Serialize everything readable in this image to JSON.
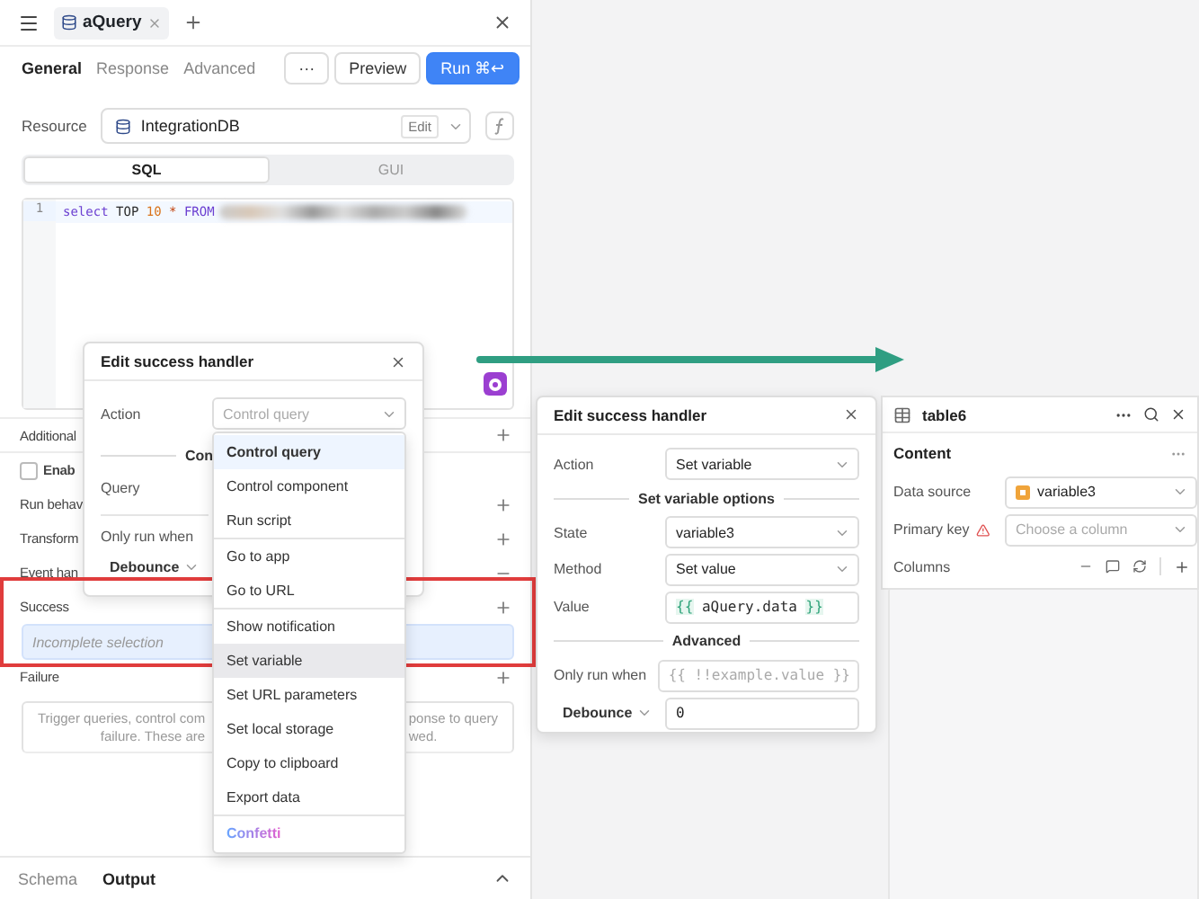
{
  "query_panel": {
    "file_tabs": [
      {
        "label": "aQuery",
        "selected": true
      }
    ],
    "tabs": [
      {
        "label": "General",
        "selected": true
      },
      {
        "label": "Response",
        "selected": false
      },
      {
        "label": "Advanced",
        "selected": false
      }
    ],
    "buttons": [
      {
        "kind": "more",
        "label": "···"
      },
      {
        "kind": "secondary",
        "label": "Preview"
      },
      {
        "kind": "primary",
        "label": "Run",
        "shortcut": "⌘↩"
      }
    ],
    "resource": {
      "label": "Resource",
      "value": "IntegrationDB",
      "edit": "Edit"
    },
    "modes": [
      {
        "label": "SQL",
        "selected": true
      },
      {
        "label": "GUI",
        "selected": false
      }
    ],
    "code": {
      "line_number": "1",
      "tokens": [
        {
          "kind": "keyword",
          "text": "select"
        },
        {
          "kind": "plain",
          "text": "TOP"
        },
        {
          "kind": "number",
          "text": "10"
        },
        {
          "kind": "operator",
          "text": "*"
        },
        {
          "kind": "keyword",
          "text": "FROM"
        }
      ]
    },
    "sections": [
      {
        "kind": "row",
        "label": "Additional",
        "expanded": false
      },
      {
        "kind": "checkbox",
        "label": "Enab",
        "checked": false
      },
      {
        "kind": "row",
        "label": "Run behav",
        "expanded": false
      },
      {
        "kind": "row",
        "label": "Transform",
        "expanded": false
      },
      {
        "kind": "row",
        "label": "Event han",
        "expanded": true
      },
      {
        "kind": "row",
        "label": "Success",
        "expanded": false
      },
      {
        "kind": "handler",
        "label": "Incomplete selection"
      },
      {
        "kind": "row",
        "label": "Failure",
        "expanded": false
      },
      {
        "kind": "help",
        "left": [
          "Trigger queries, control com",
          "failure. These are"
        ],
        "right": [
          "ponse to query",
          "wed."
        ]
      }
    ],
    "bottom_tabs": [
      {
        "label": "Schema",
        "selected": false
      },
      {
        "label": "Output",
        "selected": true
      }
    ]
  },
  "left_handler": {
    "title": "Edit success handler",
    "action_label": "Action",
    "action_placeholder": "Control query",
    "section": "Con",
    "query_label": "Query",
    "only_run_when": "Only run when",
    "debounce": "Debounce"
  },
  "action_menu": {
    "groups": [
      [
        {
          "label": "Control query",
          "selected": true,
          "hovered": false
        },
        {
          "label": "Control component",
          "selected": false,
          "hovered": false
        },
        {
          "label": "Run script",
          "selected": false,
          "hovered": false
        }
      ],
      [
        {
          "label": "Go to app",
          "selected": false,
          "hovered": false
        },
        {
          "label": "Go to URL",
          "selected": false,
          "hovered": false
        }
      ],
      [
        {
          "label": "Show notification",
          "selected": false,
          "hovered": false
        },
        {
          "label": "Set variable",
          "selected": false,
          "hovered": true
        },
        {
          "label": "Set URL parameters",
          "selected": false,
          "hovered": false
        },
        {
          "label": "Set local storage",
          "selected": false,
          "hovered": false
        },
        {
          "label": "Copy to clipboard",
          "selected": false,
          "hovered": false
        },
        {
          "label": "Export data",
          "selected": false,
          "hovered": false
        }
      ],
      [
        {
          "label": "Confetti",
          "selected": false,
          "hovered": false,
          "kind": "special"
        }
      ]
    ]
  },
  "right_handler": {
    "title": "Edit success handler",
    "rows": [
      {
        "kind": "select",
        "label": "Action",
        "value": "Set variable"
      },
      {
        "kind": "section",
        "label": "Set variable options"
      },
      {
        "kind": "select",
        "label": "State",
        "value": "variable3"
      },
      {
        "kind": "select",
        "label": "Method",
        "value": "Set value"
      },
      {
        "kind": "code",
        "label": "Value",
        "open": "{{",
        "value": "aQuery.data",
        "close": "}}"
      },
      {
        "kind": "section",
        "label": "Advanced"
      },
      {
        "kind": "input",
        "label": "Only run when",
        "placeholder": "{{ !!example.value }}"
      },
      {
        "kind": "dropdown_input",
        "label": "Debounce",
        "value": "0"
      }
    ]
  },
  "table_panel": {
    "title": "table6",
    "section": "Content",
    "rows": [
      {
        "kind": "select",
        "label": "Data source",
        "value": "variable3",
        "warning": false
      },
      {
        "kind": "select",
        "label": "Primary key",
        "placeholder": "Choose a column",
        "warning": true
      },
      {
        "kind": "tools",
        "label": "Columns"
      }
    ]
  }
}
